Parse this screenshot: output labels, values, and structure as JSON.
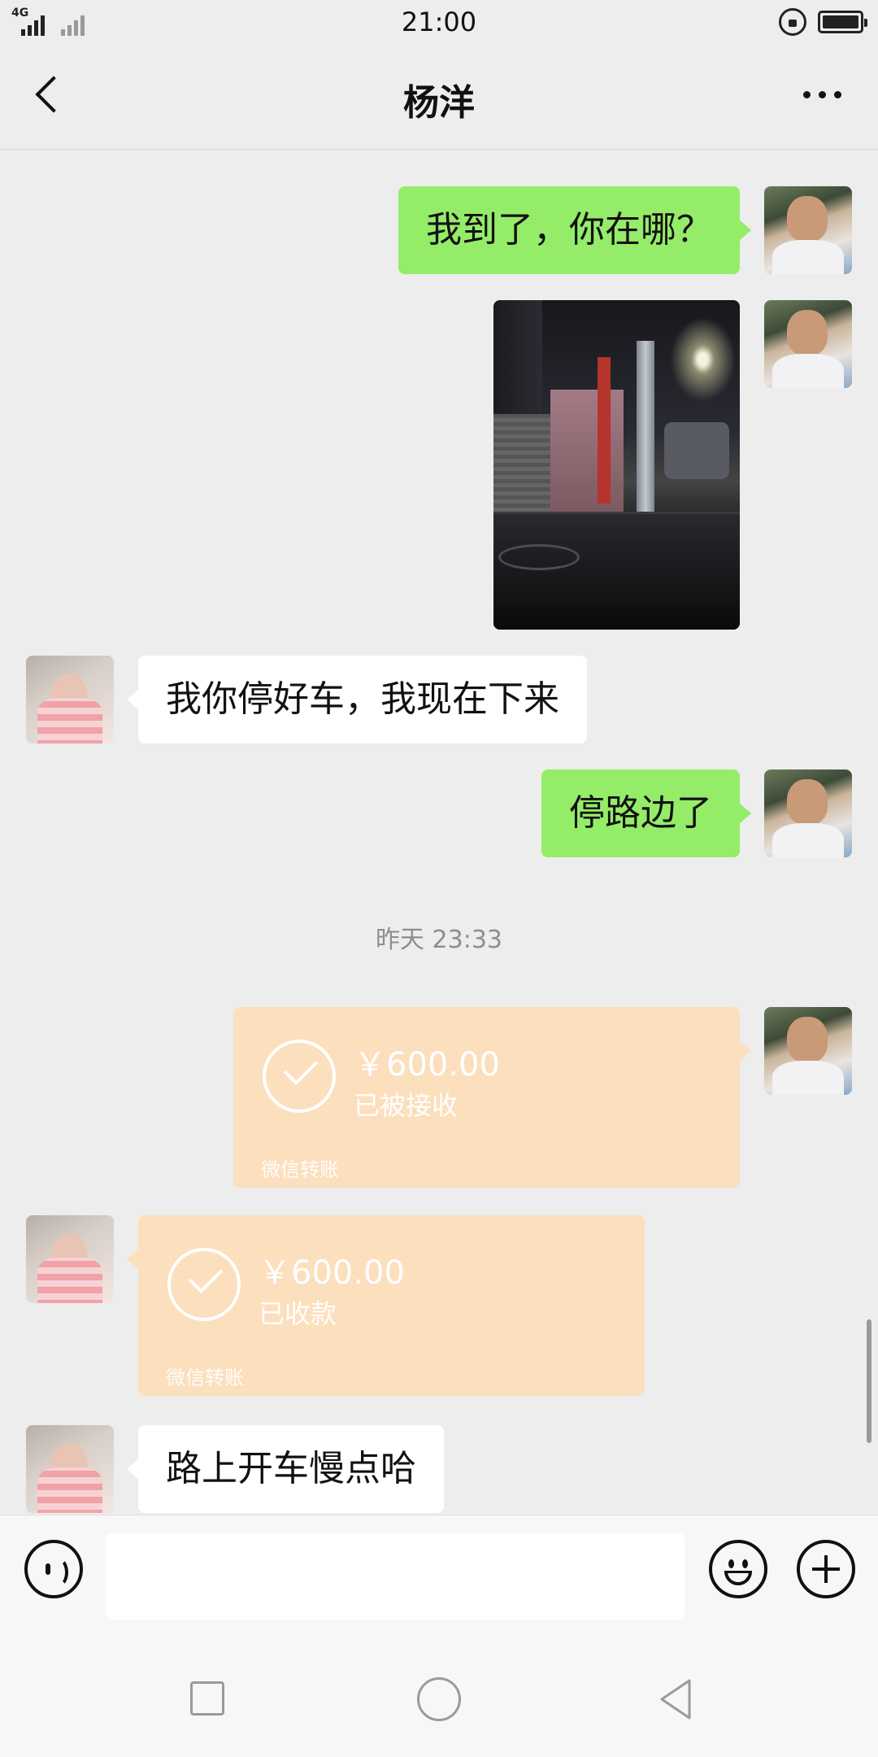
{
  "status_bar": {
    "network": "4G",
    "time": "21:00"
  },
  "header": {
    "title": "杨洋"
  },
  "messages": [
    {
      "side": "me",
      "type": "text",
      "text": "我到了，你在哪？"
    },
    {
      "side": "me",
      "type": "image"
    },
    {
      "side": "other",
      "type": "text",
      "text": "我你停好车，我现在下来"
    },
    {
      "side": "me",
      "type": "text",
      "text": "停路边了"
    },
    {
      "type": "timestamp",
      "text": "昨天 23:33"
    },
    {
      "side": "me",
      "type": "transfer",
      "amount": "￥600.00",
      "status": "已被接收",
      "label": "微信转账"
    },
    {
      "side": "other",
      "type": "transfer",
      "amount": "￥600.00",
      "status": "已收款",
      "label": "微信转账"
    },
    {
      "side": "other",
      "type": "text",
      "text": "路上开车慢点哈"
    }
  ],
  "input": {
    "value": "",
    "placeholder": ""
  },
  "colors": {
    "background": "#ededed",
    "my_bubble": "#95ec69",
    "other_bubble": "#ffffff",
    "transfer_done": "#fcdfbd"
  },
  "icons": {
    "back": "chevron-left-icon",
    "more": "more-dots-icon",
    "voice": "voice-icon",
    "emoji": "emoji-icon",
    "plus": "plus-icon"
  }
}
